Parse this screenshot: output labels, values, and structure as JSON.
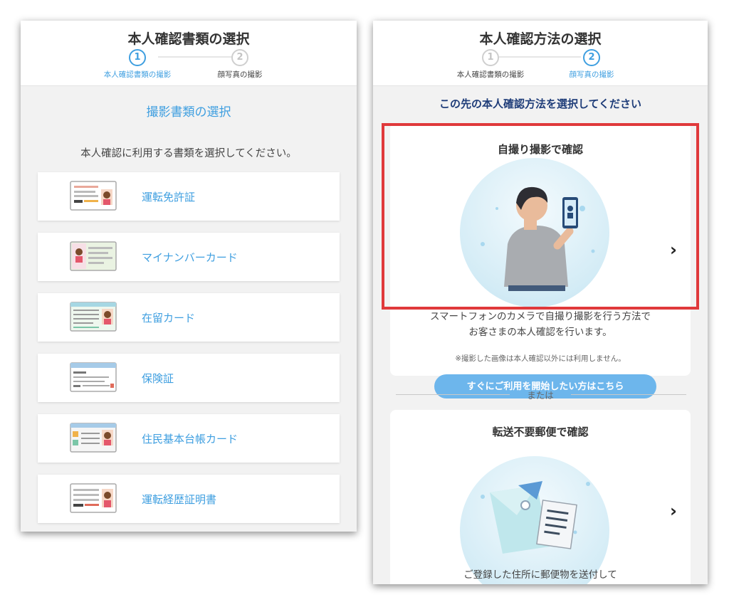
{
  "left": {
    "title": "本人確認書類の選択",
    "steps": [
      {
        "number": "1",
        "label": "本人確認書類の撮影",
        "active": true
      },
      {
        "number": "2",
        "label": "顔写真の撮影",
        "active": false
      }
    ],
    "section_title": "撮影書類の選択",
    "instruction": "本人確認に利用する書類を選択してください。",
    "documents": [
      {
        "label": "運転免許証",
        "icon": "drivers-license-icon"
      },
      {
        "label": "マイナンバーカード",
        "icon": "my-number-card-icon"
      },
      {
        "label": "在留カード",
        "icon": "residence-card-icon"
      },
      {
        "label": "保険証",
        "icon": "insurance-card-icon"
      },
      {
        "label": "住民基本台帳カード",
        "icon": "resident-registry-card-icon"
      },
      {
        "label": "運転経歴証明書",
        "icon": "driving-history-certificate-icon"
      }
    ]
  },
  "right": {
    "title": "本人確認方法の選択",
    "steps": [
      {
        "number": "1",
        "label": "本人確認書類の撮影",
        "active": false
      },
      {
        "number": "2",
        "label": "顔写真の撮影",
        "active": true
      }
    ],
    "prompt": "この先の本人確認方法を選択してください",
    "selfie": {
      "title": "自撮り撮影で確認",
      "button_label": "すぐにご利用を開始したい方はこちら",
      "description_line1": "スマートフォンのカメラで自撮り撮影を行う方法で",
      "description_line2": "お客さまの本人確認を行います。",
      "note": "※撮影した画像は本人確認以外には利用しません。"
    },
    "divider": "または",
    "mail": {
      "title": "転送不要郵便で確認",
      "description_line1": "ご登録した住所に郵便物を送付して"
    }
  },
  "colors": {
    "accent": "#3f9fe0",
    "highlight": "#e0393b",
    "button": "#6db6ec",
    "prompt": "#1f3d79"
  }
}
